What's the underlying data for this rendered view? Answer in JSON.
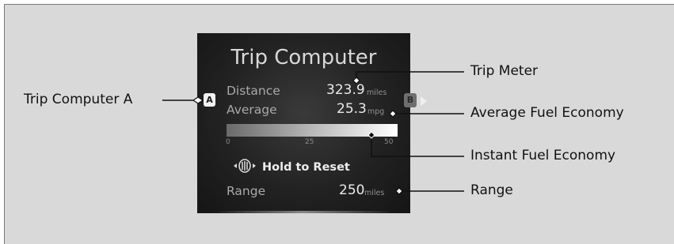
{
  "screen": {
    "title": "Trip Computer",
    "distance": {
      "label": "Distance",
      "value": "323.9",
      "unit": "miles"
    },
    "average": {
      "label": "Average",
      "value": "25.3",
      "unit": "mpg"
    },
    "instant_bar": {
      "ticks": [
        "0",
        "25",
        "50"
      ],
      "level": 50
    },
    "reset": {
      "icon": "selector-wheel-icon",
      "text": "Hold to Reset"
    },
    "range": {
      "label": "Range",
      "value": "250",
      "unit": "miles"
    },
    "badges": {
      "current": "A",
      "next": "B"
    }
  },
  "callouts": {
    "trip_computer_a": "Trip Computer A",
    "trip_meter": "Trip Meter",
    "average_fuel_economy": "Average Fuel Economy",
    "instant_fuel_economy": "Instant Fuel Economy",
    "range": "Range"
  }
}
